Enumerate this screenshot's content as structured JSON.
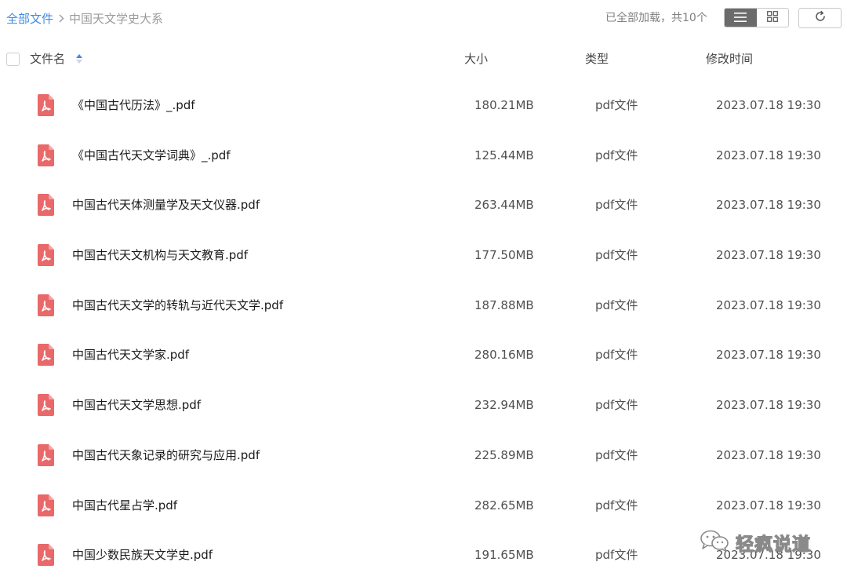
{
  "breadcrumb": {
    "root": "全部文件",
    "current": "中国天文学史大系"
  },
  "status": {
    "loaded_text": "已全部加载，共10个"
  },
  "toolbar": {
    "view_mode": "list",
    "list_view_icon": "list-icon",
    "grid_view_icon": "grid-icon",
    "refresh_icon": "refresh-icon"
  },
  "columns": {
    "name": "文件名",
    "size": "大小",
    "type": "类型",
    "modified": "修改时间",
    "sort": "name-ascending"
  },
  "files": [
    {
      "name": "《中国古代历法》_.pdf",
      "size": "180.21MB",
      "type": "pdf文件",
      "modified": "2023.07.18 19:30"
    },
    {
      "name": "《中国古代天文学词典》_.pdf",
      "size": "125.44MB",
      "type": "pdf文件",
      "modified": "2023.07.18 19:30"
    },
    {
      "name": "中国古代天体测量学及天文仪器.pdf",
      "size": "263.44MB",
      "type": "pdf文件",
      "modified": "2023.07.18 19:30"
    },
    {
      "name": "中国古代天文机构与天文教育.pdf",
      "size": "177.50MB",
      "type": "pdf文件",
      "modified": "2023.07.18 19:30"
    },
    {
      "name": "中国古代天文学的转轨与近代天文学.pdf",
      "size": "187.88MB",
      "type": "pdf文件",
      "modified": "2023.07.18 19:30"
    },
    {
      "name": "中国古代天文学家.pdf",
      "size": "280.16MB",
      "type": "pdf文件",
      "modified": "2023.07.18 19:30"
    },
    {
      "name": "中国古代天文学思想.pdf",
      "size": "232.94MB",
      "type": "pdf文件",
      "modified": "2023.07.18 19:30"
    },
    {
      "name": "中国古代天象记录的研究与应用.pdf",
      "size": "225.89MB",
      "type": "pdf文件",
      "modified": "2023.07.18 19:30"
    },
    {
      "name": "中国古代星占学.pdf",
      "size": "282.65MB",
      "type": "pdf文件",
      "modified": "2023.07.18 19:30"
    },
    {
      "name": "中国少数民族天文学史.pdf",
      "size": "191.65MB",
      "type": "pdf文件",
      "modified": "2023.07.18 19:30"
    }
  ],
  "watermark": {
    "text": "轻疯说道",
    "icon": "wechat-icon"
  },
  "colors": {
    "accent": "#3d8be8",
    "pdf_icon": "#e9686a",
    "active_toggle": "#6b6b6b",
    "muted_text": "#9b9b9b"
  }
}
